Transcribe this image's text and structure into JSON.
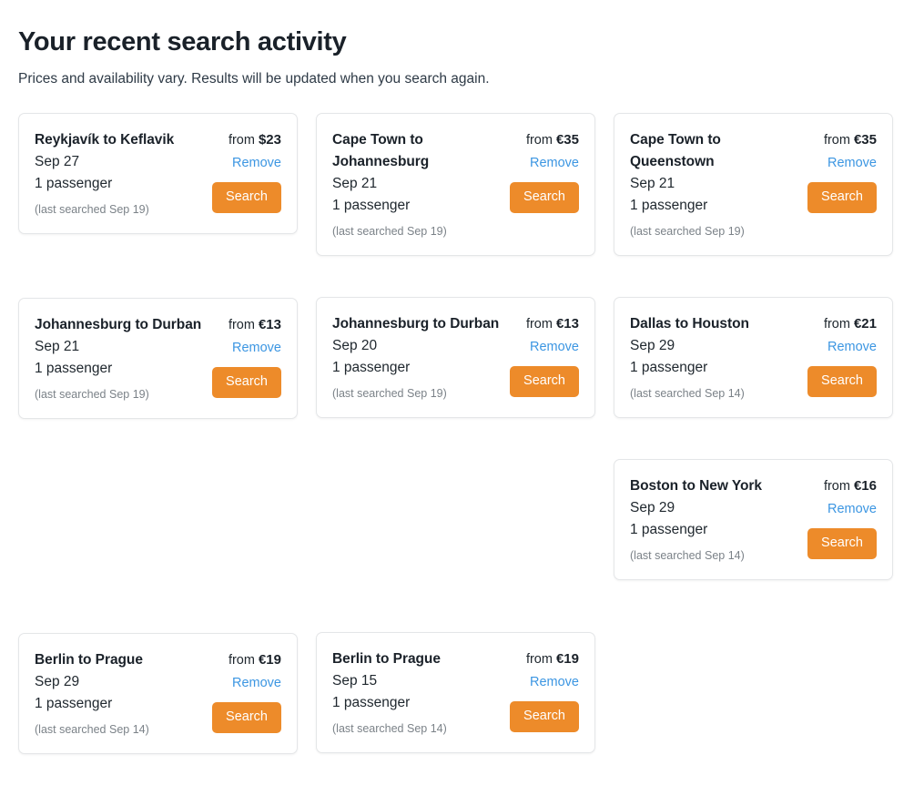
{
  "header": {
    "title": "Your recent search activity",
    "subtitle": "Prices and availability vary. Results will be updated when you search again."
  },
  "labels": {
    "from": "from",
    "remove": "Remove",
    "search": "Search"
  },
  "colors": {
    "accent_button": "#ED8B2A",
    "link": "#3C96E2",
    "title": "#1A2129",
    "muted": "#7B8288",
    "card_border": "#E4E6E8"
  },
  "columns": [
    {
      "id": "column-1",
      "cards": [
        {
          "id": "reykjavik-keflavik-sep-27",
          "route": "Reykjavík to Keflavik",
          "date": "Sep 27",
          "passengers": "1 passenger",
          "last_searched": "(last searched Sep 19)",
          "price_from": "from",
          "price": "$23",
          "remove": "Remove",
          "search": "Search"
        },
        {
          "id": "johannesburg-durban-sep-21",
          "route": "Johannesburg to Durban",
          "date": "Sep 21",
          "passengers": "1 passenger",
          "last_searched": "(last searched Sep 19)",
          "price_from": "from",
          "price": "€13",
          "remove": "Remove",
          "search": "Search"
        },
        {
          "id": "berlin-prague-sep-29",
          "route": "Berlin to Prague",
          "date": "Sep 29",
          "passengers": "1 passenger",
          "last_searched": "(last searched Sep 14)",
          "price_from": "from",
          "price": "€19",
          "remove": "Remove",
          "search": "Search"
        }
      ]
    },
    {
      "id": "column-2",
      "cards": [
        {
          "id": "cape-town-johannesburg-sep-21",
          "route": "Cape Town to Johannesburg",
          "date": "Sep 21",
          "passengers": "1 passenger",
          "last_searched": "(last searched Sep 19)",
          "price_from": "from",
          "price": "€35",
          "remove": "Remove",
          "search": "Search"
        },
        {
          "id": "johannesburg-durban-sep-20",
          "route": "Johannesburg to Durban",
          "date": "Sep 20",
          "passengers": "1 passenger",
          "last_searched": "(last searched Sep 19)",
          "price_from": "from",
          "price": "€13",
          "remove": "Remove",
          "search": "Search"
        },
        {
          "id": "berlin-prague-sep-15",
          "route": "Berlin to Prague",
          "date": "Sep 15",
          "passengers": "1 passenger",
          "last_searched": "(last searched Sep 14)",
          "price_from": "from",
          "price": "€19",
          "remove": "Remove",
          "search": "Search"
        }
      ]
    },
    {
      "id": "column-3",
      "cards": [
        {
          "id": "cape-town-queenstown-sep-21",
          "route": "Cape Town to Queenstown",
          "date": "Sep 21",
          "passengers": "1 passenger",
          "last_searched": "(last searched Sep 19)",
          "price_from": "from",
          "price": "€35",
          "remove": "Remove",
          "search": "Search"
        },
        {
          "id": "dallas-houston-sep-29",
          "route": "Dallas to Houston",
          "date": "Sep 29",
          "passengers": "1 passenger",
          "last_searched": "(last searched Sep 14)",
          "price_from": "from",
          "price": "€21",
          "remove": "Remove",
          "search": "Search"
        },
        {
          "id": "boston-new-york-sep-29",
          "route": "Boston to New York",
          "date": "Sep 29",
          "passengers": "1 passenger",
          "last_searched": "(last searched Sep 14)",
          "price_from": "from",
          "price": "€16",
          "remove": "Remove",
          "search": "Search"
        }
      ]
    }
  ]
}
